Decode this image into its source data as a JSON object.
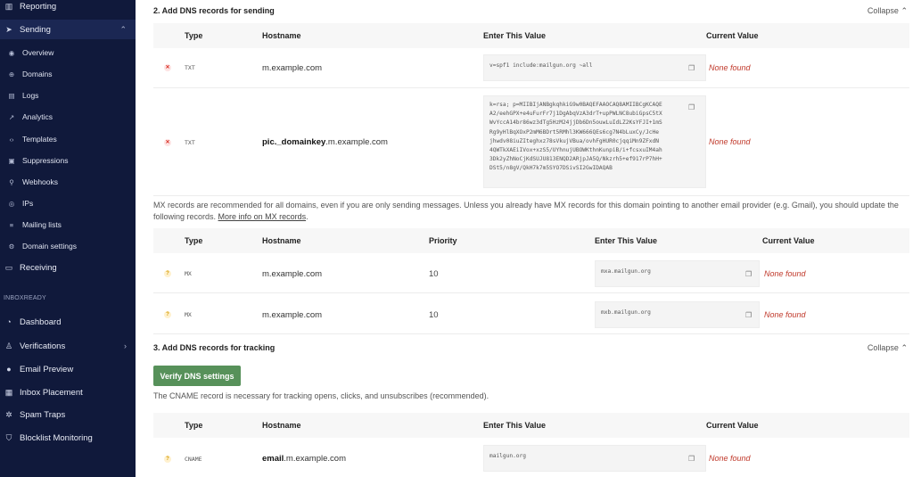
{
  "sidebar": {
    "reporting": "Reporting",
    "sending": "Sending",
    "sub_items": [
      "Overview",
      "Domains",
      "Logs",
      "Analytics",
      "Templates",
      "Suppressions",
      "Webhooks",
      "IPs",
      "Mailing lists",
      "Domain settings"
    ],
    "receiving": "Receiving",
    "section_label": "INBOXREADY",
    "inbox_items": [
      "Dashboard",
      "Verifications",
      "Email Preview",
      "Inbox Placement",
      "Spam Traps",
      "Blocklist Monitoring"
    ]
  },
  "sending_section": {
    "title": "2. Add DNS records for sending",
    "collapse": "Collapse",
    "headers": {
      "type": "Type",
      "hostname": "Hostname",
      "value": "Enter This Value",
      "current": "Current Value"
    },
    "rows": [
      {
        "type": "TXT",
        "hostname": "m.example.com",
        "value": "v=spf1 include:mailgun.org ~all",
        "current": "None found"
      },
      {
        "type": "TXT",
        "hostname_bold": "pic._domainkey",
        "hostname_rest": ".m.example.com",
        "value_lines": [
          "k=rsa; p=MIIBIjANBgkqhkiG9w0BAQEFAAOCAQ8AMIIBCgKCAQE",
          "A2/eehGPX+e4uFurFr7j1DgAbqVzA3drT+upPWLNC8ubiGpsC5tX",
          "WvYccA14br86wz3dTg5HzM24jjDb6Dn5ouwLuIdLZ2KsYFJI+1mS",
          "Rg9yHlBqXOxP2mM6BDrt5RMhl3KW666QEs6cg7N4bLuxCy/JcHe",
          "jhwdv08iuZIteghxz78sVkujVBua/ovhFgHUR0cjqqiMn9ZFxdN",
          "4QWTkXAEiIVox+xzS5/UYhnujUBOWKthnKunpiB/i+fcsxuIM4ah",
          "3Dk2yZhNoCjKdSUJU813ENQD2ARjpJA5Q/Nkzrh5+ef917rP7hH+",
          "DSt5/n8gV/QkH7k7m5SYO7DSivSI2GwIDAQAB"
        ],
        "current": "None found"
      }
    ],
    "mx_note": "MX records are recommended for all domains, even if you are only sending messages. Unless you already have MX records for this domain pointing to another email provider (e.g. Gmail), you should update the following records.",
    "mx_link": "More info on MX records",
    "mx_headers": {
      "type": "Type",
      "hostname": "Hostname",
      "priority": "Priority",
      "value": "Enter This Value",
      "current": "Current Value"
    },
    "mx_rows": [
      {
        "type": "MX",
        "hostname": "m.example.com",
        "priority": "10",
        "value": "mxa.mailgun.org",
        "current": "None found"
      },
      {
        "type": "MX",
        "hostname": "m.example.com",
        "priority": "10",
        "value": "mxb.mailgun.org",
        "current": "None found"
      }
    ]
  },
  "tracking_section": {
    "title": "3. Add DNS records for tracking",
    "collapse": "Collapse",
    "verify_button": "Verify DNS settings",
    "note": "The CNAME record is necessary for tracking opens, clicks, and unsubscribes (recommended).",
    "headers": {
      "type": "Type",
      "hostname": "Hostname",
      "value": "Enter This Value",
      "current": "Current Value"
    },
    "rows": [
      {
        "type": "CNAME",
        "hostname_bold": "email",
        "hostname_rest": ".m.example.com",
        "value": "mailgun.org",
        "current": "None found"
      }
    ]
  },
  "colors": {
    "sidebar_bg": "#10193b",
    "error": "#c0392b",
    "button": "#57915a"
  },
  "icons": {
    "error": "x-circle-icon",
    "warning": "question-circle-icon",
    "copy": "copy-icon"
  }
}
